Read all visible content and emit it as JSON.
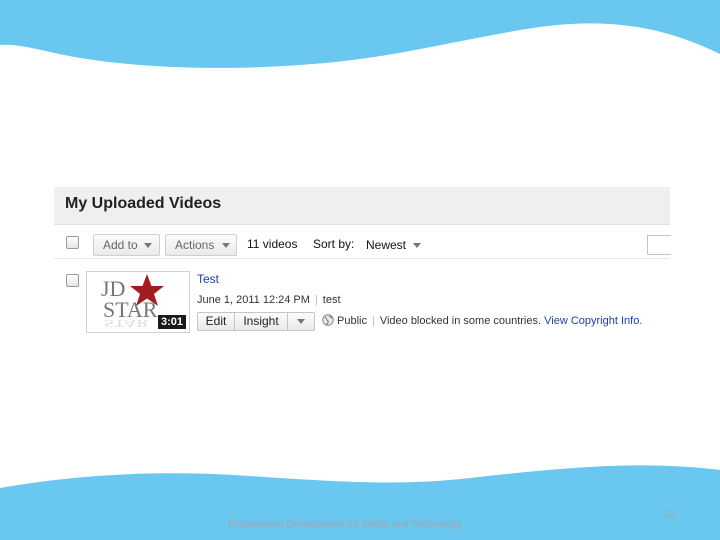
{
  "panel": {
    "title": "My Uploaded Videos",
    "add_to_label": "Add to",
    "actions_label": "Actions",
    "video_count": "11 videos",
    "sort_label": "Sort by:",
    "sort_value": "Newest"
  },
  "video": {
    "title": "Test",
    "date": "June 1, 2011 12:24 PM",
    "description": "test",
    "duration": "3:01",
    "thumbnail_text": [
      "JD",
      "STAR"
    ],
    "edit_label": "Edit",
    "insight_label": "Insight",
    "privacy": "Public",
    "status_text": "Video blocked in some countries.",
    "copyright_link": "View Copyright Info."
  },
  "slide": {
    "footer": "Professional Development for Media and Technology",
    "page_number": "13"
  },
  "colors": {
    "wave": "#6ac7ef",
    "link": "#1c3fa8",
    "star": "#a31d20",
    "header_bg": "#efefef"
  },
  "icons": [
    "globe-icon",
    "chevron-down-icon",
    "star-icon",
    "checkbox"
  ]
}
